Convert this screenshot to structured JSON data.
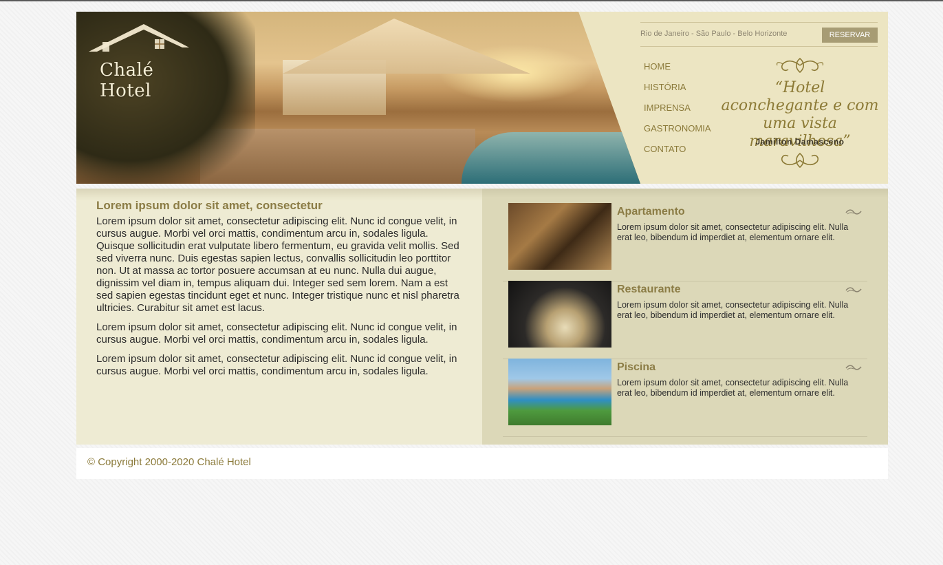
{
  "brand": {
    "name": "Chalé Hotel"
  },
  "header": {
    "cities": "Rio de Janeiro - São Paulo - Belo Horizonte",
    "reserve_label": "RESERVAR"
  },
  "nav": {
    "items": [
      {
        "label": "HOME"
      },
      {
        "label": "HISTÓRIA"
      },
      {
        "label": "IMPRENSA"
      },
      {
        "label": "GASTRONOMIA"
      },
      {
        "label": "CONTATO"
      }
    ]
  },
  "quote": {
    "text": "“Hotel aconchegante e com uma vista maravilhosa”",
    "author": "Jamilton Damasceno"
  },
  "main": {
    "title": "Lorem ipsum dolor sit amet, consectetur",
    "paragraphs": [
      "Lorem ipsum dolor sit amet, consectetur adipiscing elit. Nunc id congue velit, in cursus augue. Morbi vel orci mattis, condimentum arcu in, sodales ligula. Quisque sollicitudin erat vulputate libero fermentum, eu gravida velit mollis. Sed sed viverra nunc. Duis egestas sapien lectus, convallis sollicitudin leo porttitor non. Ut at massa ac tortor posuere accumsan at eu nunc. Nulla dui augue, dignissim vel diam in, tempus aliquam dui. Integer sed sem lorem. Nam a est sed sapien egestas tincidunt eget et nunc. Integer tristique nunc et nisl pharetra ultricies. Curabitur sit amet est lacus.",
      "Lorem ipsum dolor sit amet, consectetur adipiscing elit. Nunc id congue velit, in cursus augue. Morbi vel orci mattis, condimentum arcu in, sodales ligula.",
      "Lorem ipsum dolor sit amet, consectetur adipiscing elit. Nunc id congue velit, in cursus augue. Morbi vel orci mattis, condimentum arcu in, sodales ligula."
    ]
  },
  "features": [
    {
      "title": "Apartamento",
      "text": "Lorem ipsum dolor sit amet, consectetur adipiscing elit. Nulla erat leo, bibendum id imperdiet at, elementum ornare elit."
    },
    {
      "title": "Restaurante",
      "text": "Lorem ipsum dolor sit amet, consectetur adipiscing elit. Nulla erat leo, bibendum id imperdiet at, elementum ornare elit."
    },
    {
      "title": "Piscina",
      "text": "Lorem ipsum dolor sit amet, consectetur adipiscing elit. Nulla erat leo, bibendum id imperdiet at, elementum ornare elit."
    }
  ],
  "footer": {
    "copyright": "© Copyright 2000-2020 Chalé Hotel"
  },
  "colors": {
    "accent": "#8b7c45",
    "button": "#a79c74",
    "panel": "#eeebd3"
  }
}
